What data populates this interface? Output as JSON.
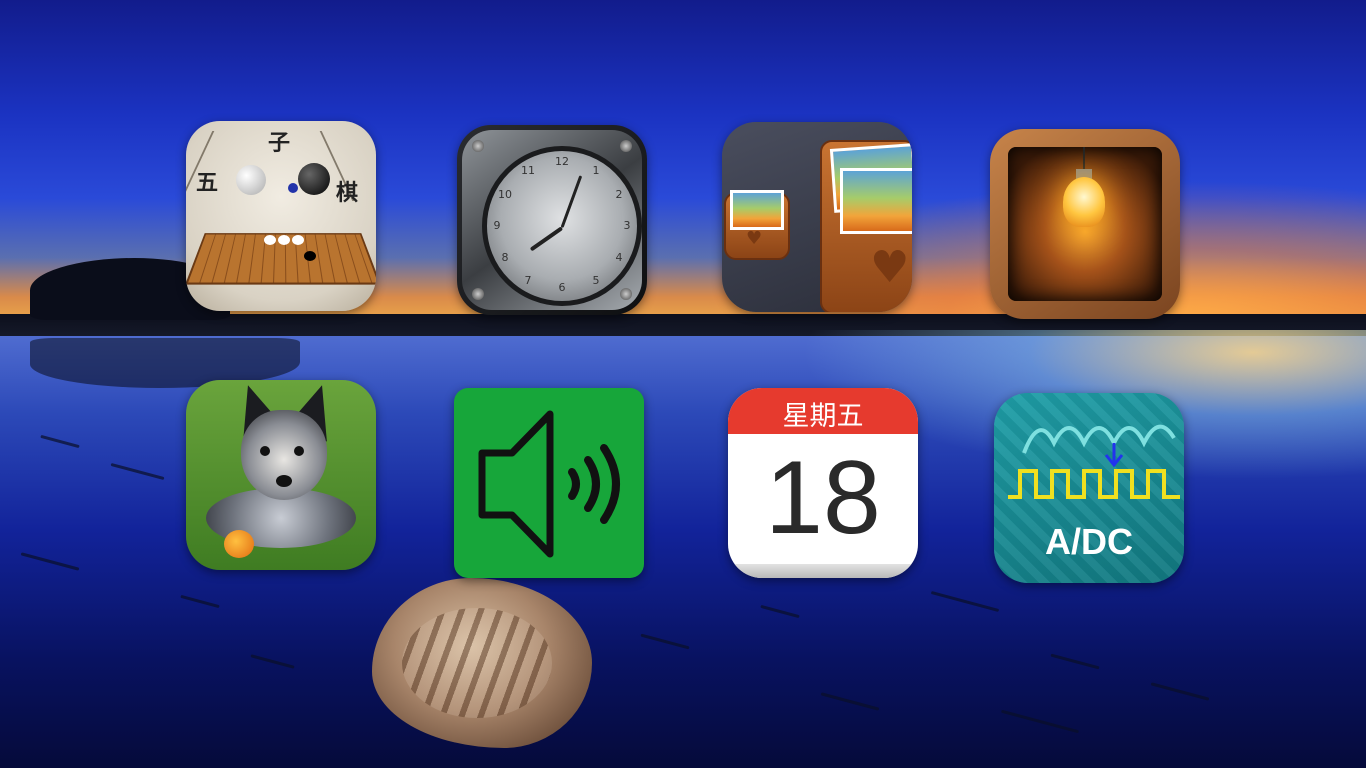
{
  "desktop": {
    "icons": [
      {
        "id": "gomoku",
        "name": "gomoku-icon",
        "chars": [
          "子",
          "五",
          "棋"
        ]
      },
      {
        "id": "clock",
        "name": "clock-icon",
        "numbers": [
          "12",
          "1",
          "2",
          "3",
          "4",
          "5",
          "6",
          "7",
          "8",
          "9",
          "10",
          "11"
        ]
      },
      {
        "id": "photo-box",
        "name": "photo-box-icon"
      },
      {
        "id": "lamp",
        "name": "light-bulb-icon"
      },
      {
        "id": "dog",
        "name": "dog-photo-icon"
      },
      {
        "id": "sound",
        "name": "speaker-icon"
      },
      {
        "id": "calendar",
        "name": "calendar-icon",
        "weekday": "星期五",
        "date": "18"
      },
      {
        "id": "adc",
        "name": "adc-icon",
        "label": "A/DC"
      }
    ],
    "colors": {
      "calendar_red": "#e63a2e",
      "sound_green": "#17a63a",
      "adc_wave": "#f0e020",
      "adc_arrow": "#2233ee"
    }
  }
}
